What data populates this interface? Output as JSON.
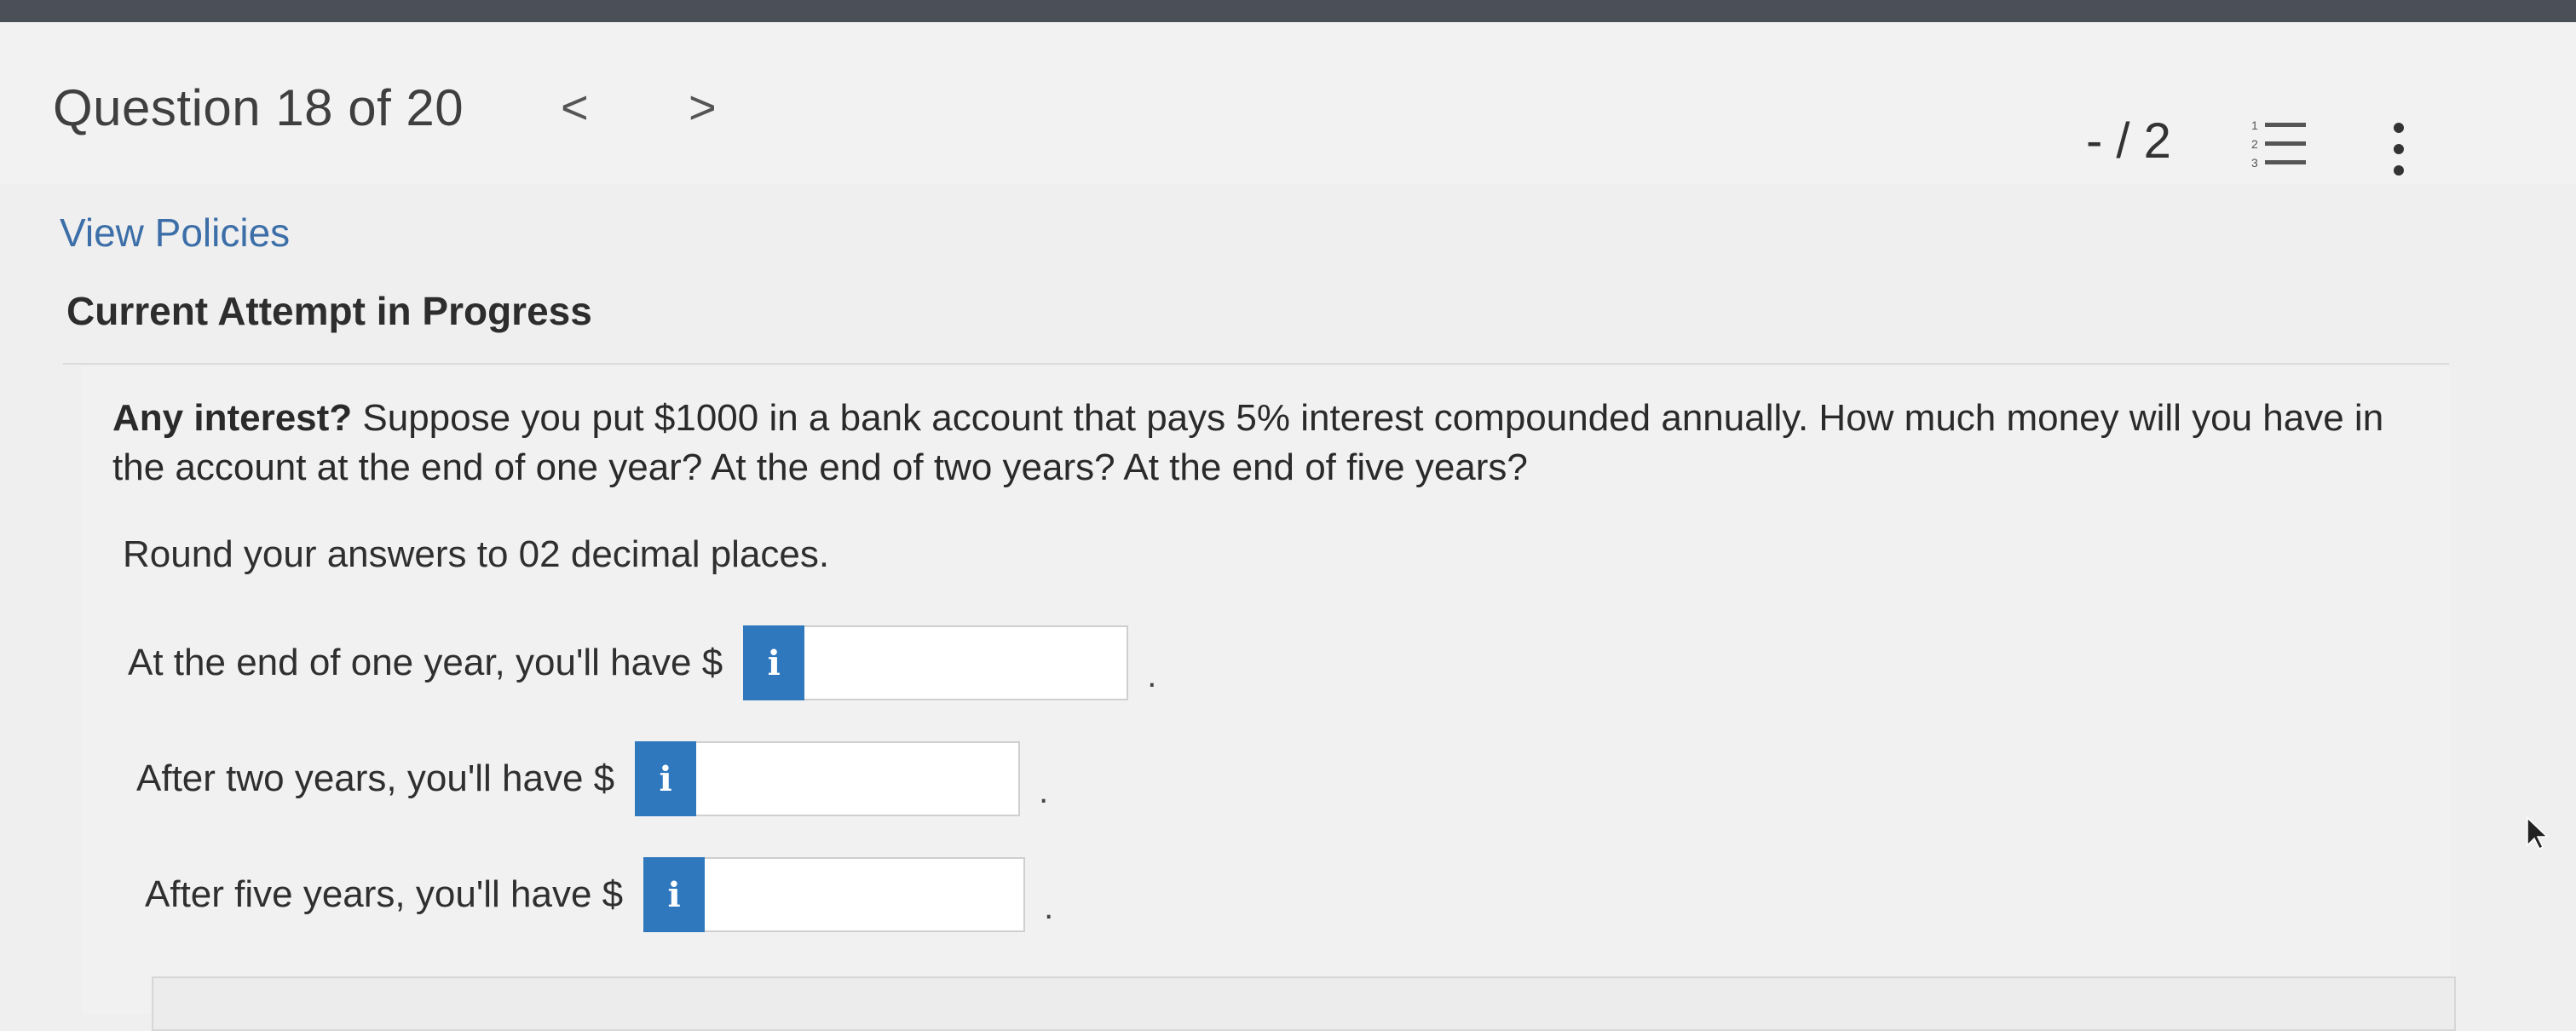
{
  "header": {
    "question_counter": "Question 18 of 20",
    "prev_glyph": "<",
    "next_glyph": ">",
    "score": "- / 2"
  },
  "links": {
    "view_policies": "View Policies"
  },
  "section": {
    "title": "Current Attempt in Progress"
  },
  "question": {
    "lead": "Any interest?",
    "body": " Suppose you put $1000 in a bank account that pays 5% interest compounded annually. How much money will you have in the account at the end of one year? At the end of two years? At the end of five years?",
    "round_note": "Round your answers to 02 decimal places."
  },
  "answers": [
    {
      "label": "At the end of one year, you'll have $",
      "info": "i",
      "value": "",
      "suffix": "."
    },
    {
      "label": "After two years, you'll have $",
      "info": "i",
      "value": "",
      "suffix": "."
    },
    {
      "label": "After five years, you'll have $",
      "info": "i",
      "value": "",
      "suffix": "."
    }
  ],
  "colors": {
    "info_button": "#2f78be",
    "link": "#3c6ea8",
    "top_strip": "#4a4f58"
  },
  "icons": {
    "prev": "chevron-left-icon",
    "next": "chevron-right-icon",
    "list": "numbered-list-icon",
    "more": "more-vertical-icon",
    "info": "info-icon"
  }
}
